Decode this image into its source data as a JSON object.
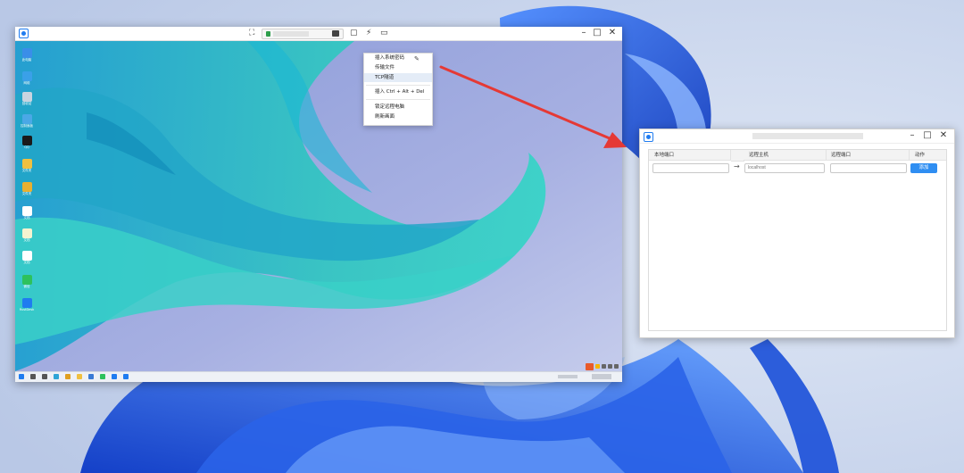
{
  "remote_window": {
    "menu": {
      "items": [
        {
          "label": "插入系统密码",
          "highlighted": false
        },
        {
          "label": "传输文件",
          "highlighted": false
        },
        {
          "label": "TCP隧道",
          "highlighted": true
        },
        {
          "label": "插入 Ctrl + Alt + Del",
          "highlighted": false
        },
        {
          "label": "锁定远程电脑",
          "highlighted": false
        },
        {
          "label": "刷新画面",
          "highlighted": false
        }
      ]
    },
    "desktop_icons": [
      {
        "label": "此电脑",
        "icon": "computer-icon",
        "color": "#3a8ee8"
      },
      {
        "label": "网络",
        "icon": "network-icon",
        "color": "#3aa0e8"
      },
      {
        "label": "回收站",
        "icon": "recycle-bin-icon",
        "color": "#c9d4e0"
      },
      {
        "label": "控制面板",
        "icon": "control-panel-icon",
        "color": "#4aa8e6"
      },
      {
        "label": "QQ",
        "icon": "qq-icon",
        "color": "#1a1a1a"
      },
      {
        "label": "文件夹",
        "icon": "folder-icon",
        "color": "#f0c040"
      },
      {
        "label": "文件夹",
        "icon": "folder-icon",
        "color": "#e8b030"
      },
      {
        "label": "文档",
        "icon": "document-icon",
        "color": "#ffffff"
      },
      {
        "label": "文档",
        "icon": "document-icon",
        "color": "#f5f3d0"
      },
      {
        "label": "文档",
        "icon": "document-icon",
        "color": "#ffffff"
      },
      {
        "label": "微信",
        "icon": "wechat-icon",
        "color": "#2dc15c"
      },
      {
        "label": "RustDesk",
        "icon": "rustdesk-icon",
        "color": "#1f7cf0"
      }
    ],
    "taskbar": {
      "apps": [
        {
          "icon": "start-icon",
          "color": "#1f7cf0"
        },
        {
          "icon": "search-icon",
          "color": "#555555"
        },
        {
          "icon": "task-view-icon",
          "color": "#555555"
        },
        {
          "icon": "edge-icon",
          "color": "#2fa5d6"
        },
        {
          "icon": "chrome-icon",
          "color": "#e0a020"
        },
        {
          "icon": "explorer-icon",
          "color": "#f0c040"
        },
        {
          "icon": "store-icon",
          "color": "#3a7bd5"
        },
        {
          "icon": "wechat-icon",
          "color": "#2dc15c"
        },
        {
          "icon": "rustdesk-icon",
          "color": "#1f7cf0"
        },
        {
          "icon": "app-icon",
          "color": "#1f7cf0"
        }
      ]
    }
  },
  "tcp_window": {
    "columns": [
      "本地端口",
      "",
      "远程主机",
      "远程端口",
      "动作"
    ],
    "local_port": {
      "value": "",
      "placeholder": ""
    },
    "arrow": "→",
    "remote_host": {
      "value": "",
      "placeholder": "localhost"
    },
    "remote_port": {
      "value": "",
      "placeholder": ""
    },
    "add_button": "添加"
  },
  "colors": {
    "accent": "#2f8ef2",
    "annotation_arrow": "#e53935",
    "teal_cloth": "#2ec7c0",
    "blue_bloom": "#1a4fd8"
  }
}
